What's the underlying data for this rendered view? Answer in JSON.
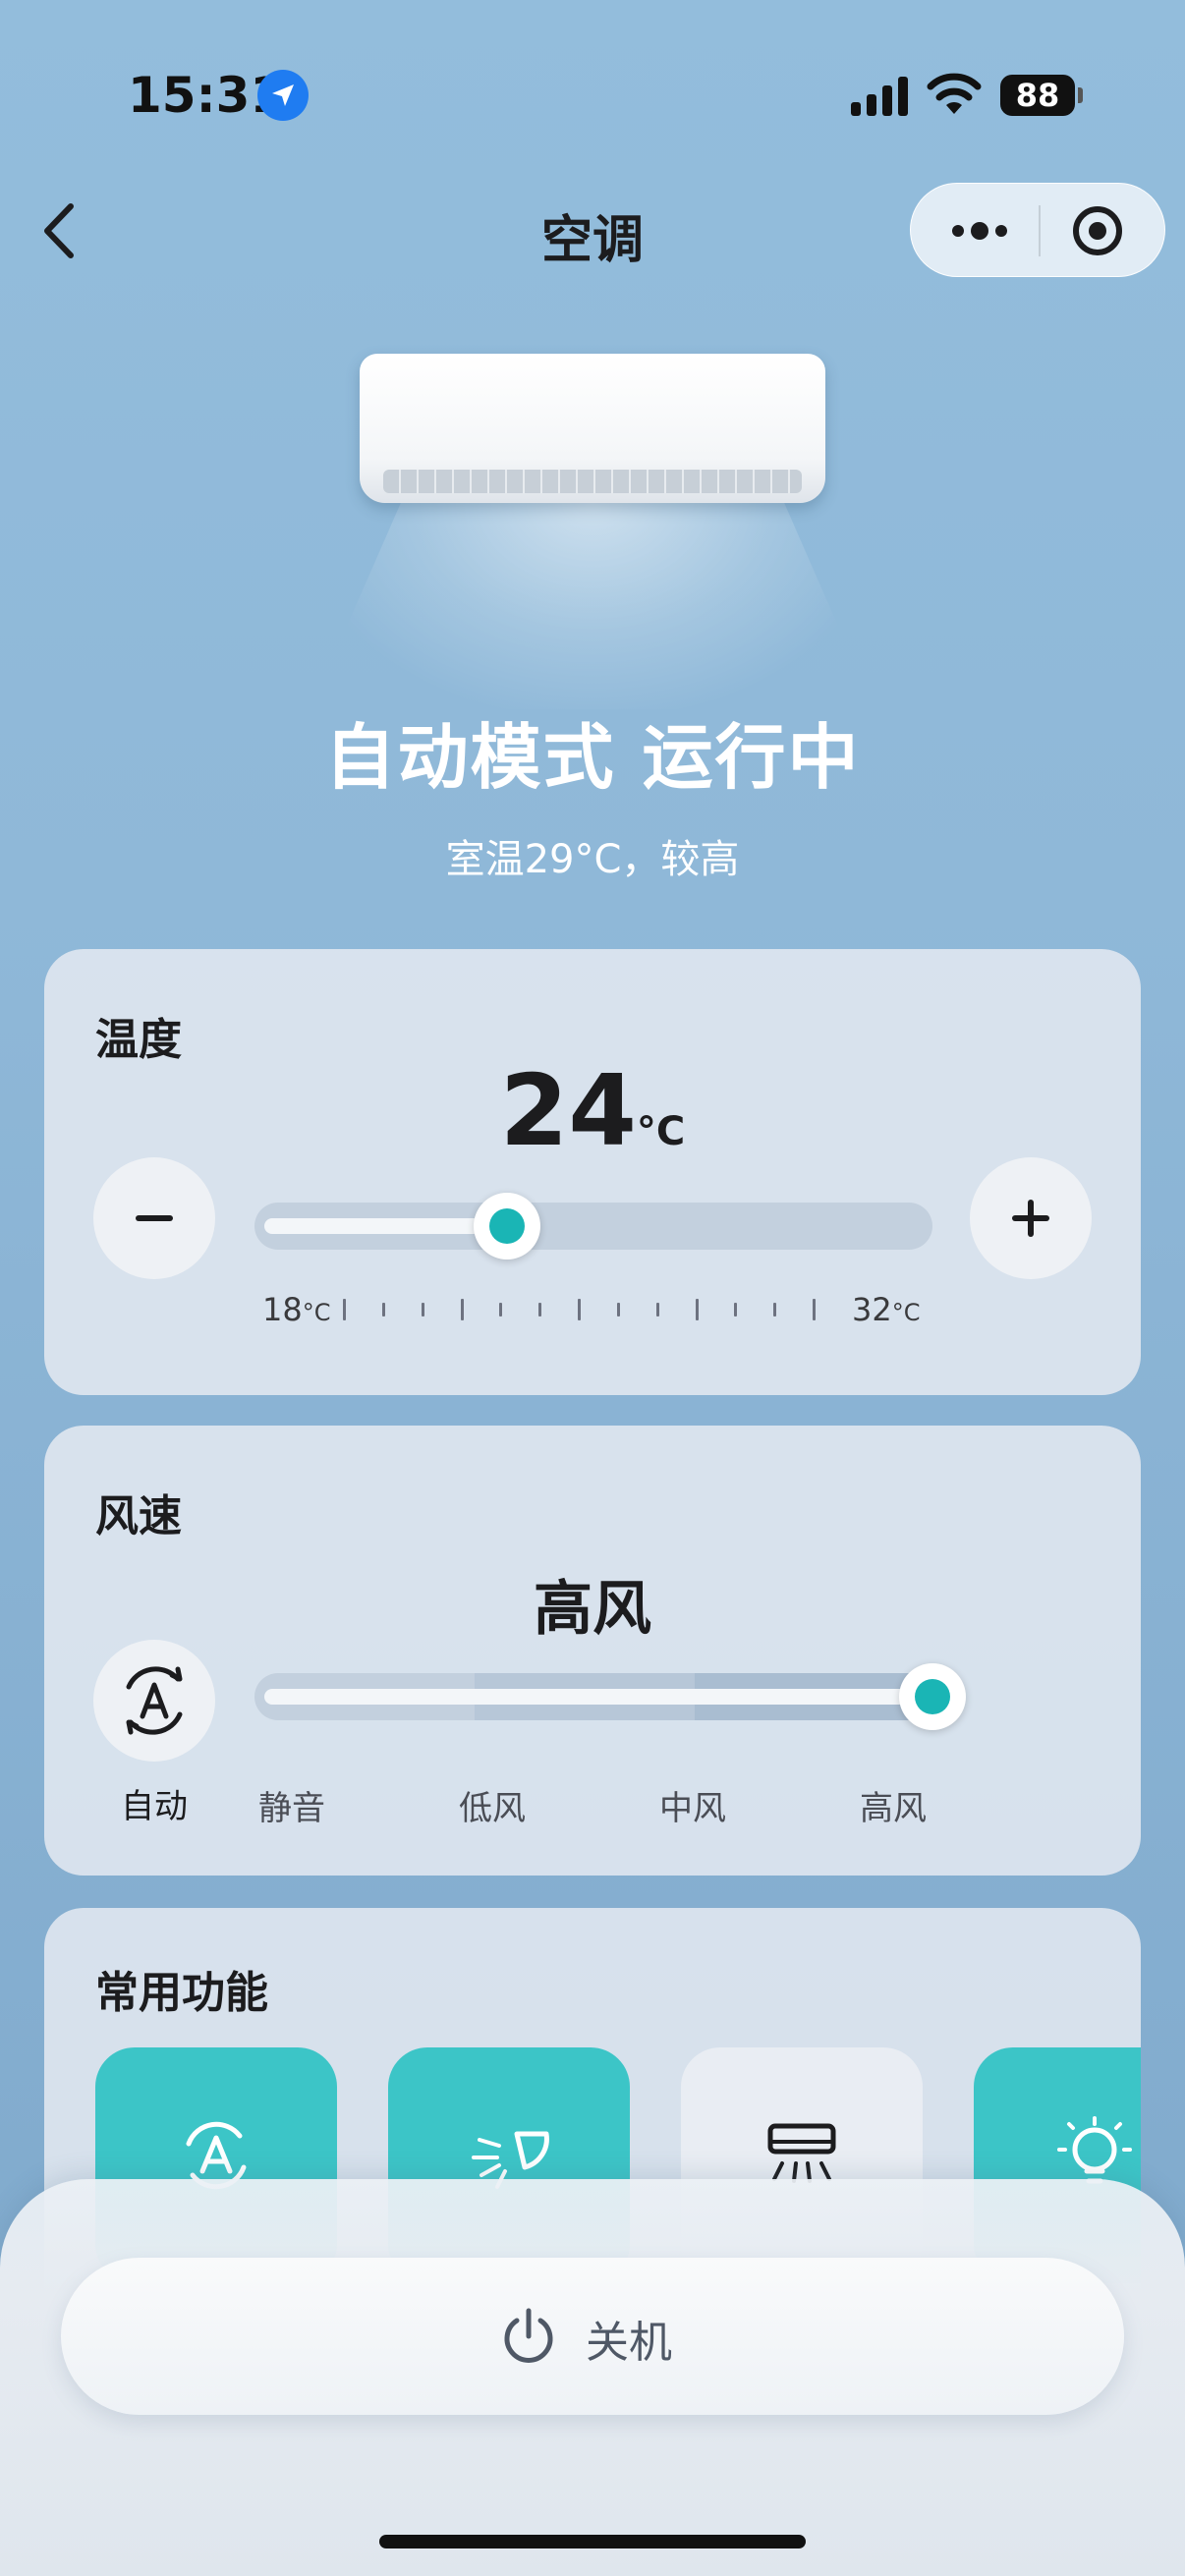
{
  "status_bar": {
    "time": "15:31",
    "battery": "88",
    "icons": [
      "location-arrow-icon",
      "cellular-signal-icon",
      "wifi-icon",
      "battery-icon"
    ]
  },
  "nav": {
    "title": "空调",
    "icons": [
      "back-chevron-icon",
      "more-dots-icon",
      "target-circle-icon"
    ]
  },
  "device": {
    "status_title": "自动模式 运行中",
    "room_temp": "室温29°C，较高"
  },
  "temperature": {
    "title": "温度",
    "value": "24",
    "unit": "°C",
    "min_label": "18",
    "max_label": "32",
    "scale_unit": "°C",
    "min": 18,
    "max": 32,
    "current": 24,
    "decrease_icon": "minus-icon",
    "increase_icon": "plus-icon",
    "accent_color": "#1ab5b5"
  },
  "wind": {
    "title": "风速",
    "value": "高风",
    "auto_label": "自动",
    "auto_icon": "auto-mode-icon",
    "levels": [
      "静音",
      "低风",
      "中风",
      "高风"
    ],
    "selected_index": 3
  },
  "functions": {
    "title": "常用功能",
    "tiles": [
      {
        "icon": "auto-mode-icon",
        "active": true
      },
      {
        "icon": "swing-fan-icon",
        "active": true
      },
      {
        "icon": "ac-airflow-icon",
        "active": false
      },
      {
        "icon": "light-bulb-icon",
        "active": true
      }
    ],
    "active_color": "#3cc5c7"
  },
  "power": {
    "label": "关机",
    "icon": "power-icon"
  }
}
